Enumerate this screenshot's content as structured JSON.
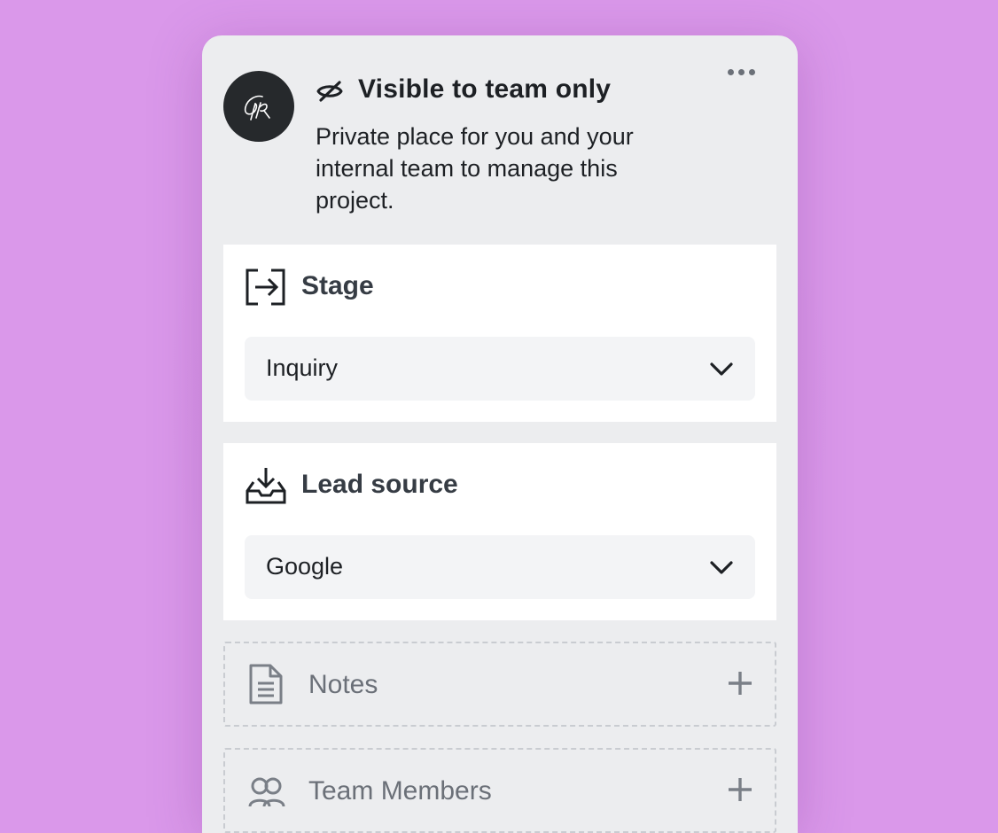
{
  "panel": {
    "visibility": {
      "title": "Visible to team only",
      "description": "Private place for you and your internal team to manage this project."
    },
    "sections": [
      {
        "title": "Stage",
        "icon": "stage-arrow-icon",
        "value": "Inquiry"
      },
      {
        "title": "Lead source",
        "icon": "inbox-download-icon",
        "value": "Google"
      }
    ],
    "collapsed": [
      {
        "label": "Notes",
        "icon": "document-icon"
      },
      {
        "label": "Team Members",
        "icon": "users-icon"
      }
    ]
  },
  "colors": {
    "background": "#da98ea",
    "panel": "#ecedef",
    "avatar": "#26292c",
    "card": "#ffffff",
    "select": "#f3f4f6",
    "muted": "#6b7078"
  }
}
